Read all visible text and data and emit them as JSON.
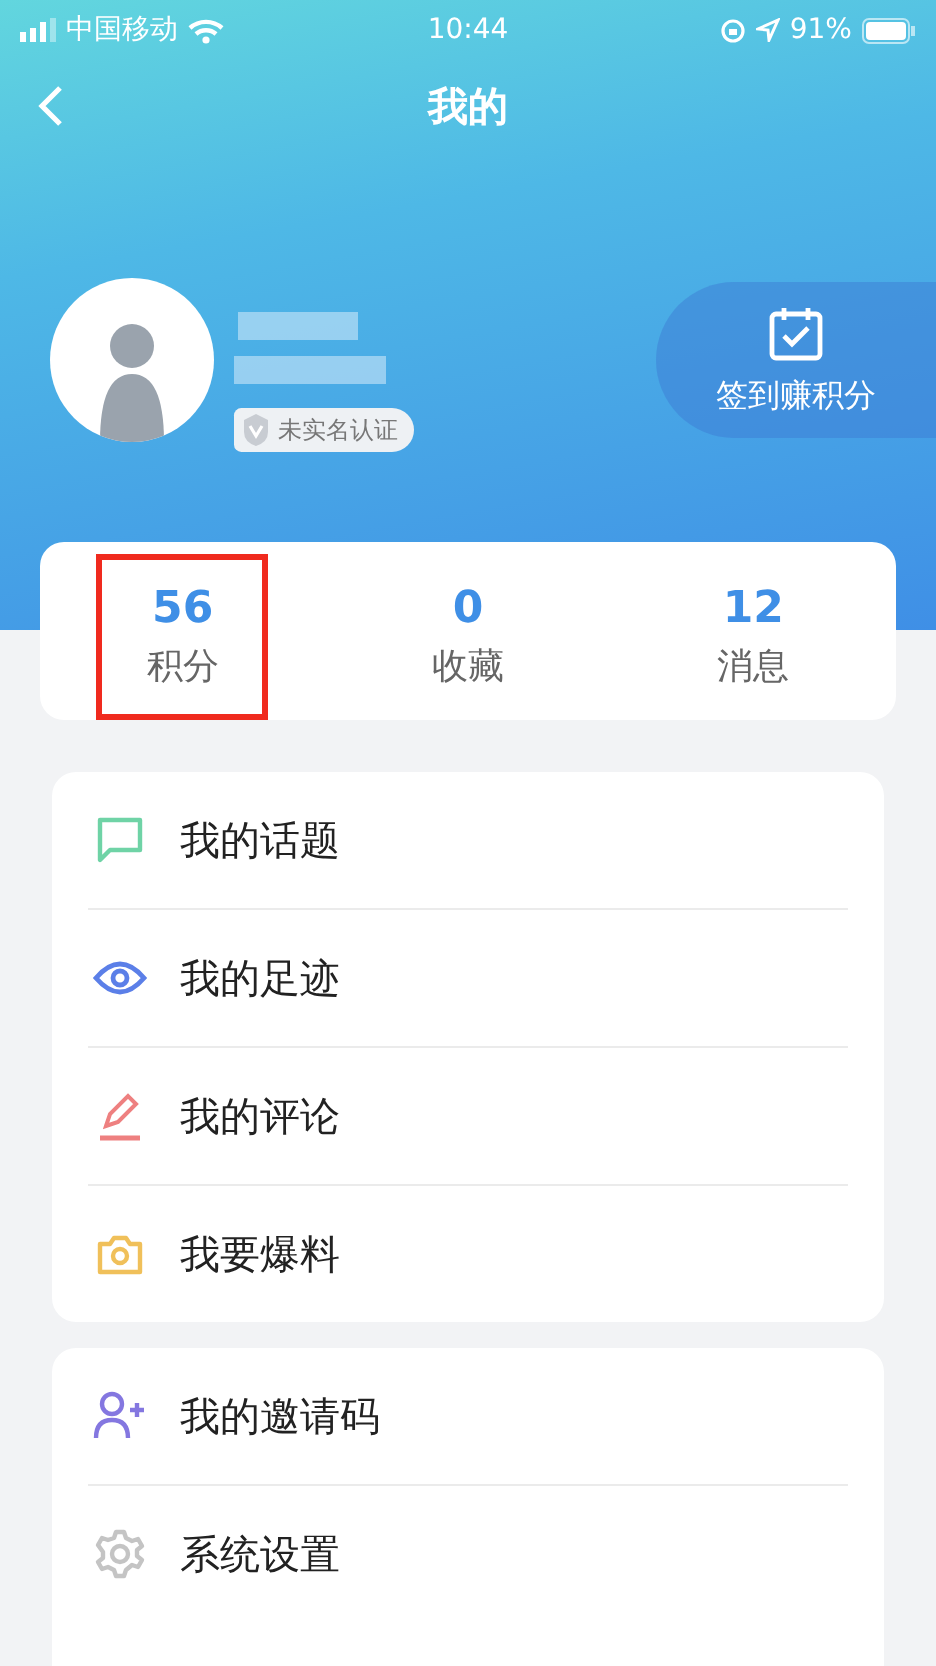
{
  "status_bar": {
    "carrier": "中国移动",
    "time": "10:44",
    "battery": "91%"
  },
  "nav": {
    "title": "我的"
  },
  "profile": {
    "badge": "未实名认证",
    "checkin": "签到赚积分"
  },
  "stats": [
    {
      "value": "56",
      "label": "积分",
      "highlighted": true
    },
    {
      "value": "0",
      "label": "收藏",
      "highlighted": false
    },
    {
      "value": "12",
      "label": "消息",
      "highlighted": false
    }
  ],
  "menu_groups": [
    [
      {
        "kind": "chat",
        "label": "我的话题"
      },
      {
        "kind": "eye",
        "label": "我的足迹"
      },
      {
        "kind": "pencil",
        "label": "我的评论"
      },
      {
        "kind": "camera",
        "label": "我要爆料"
      }
    ],
    [
      {
        "kind": "invite",
        "label": "我的邀请码"
      },
      {
        "kind": "settings",
        "label": "系统设置"
      }
    ]
  ]
}
